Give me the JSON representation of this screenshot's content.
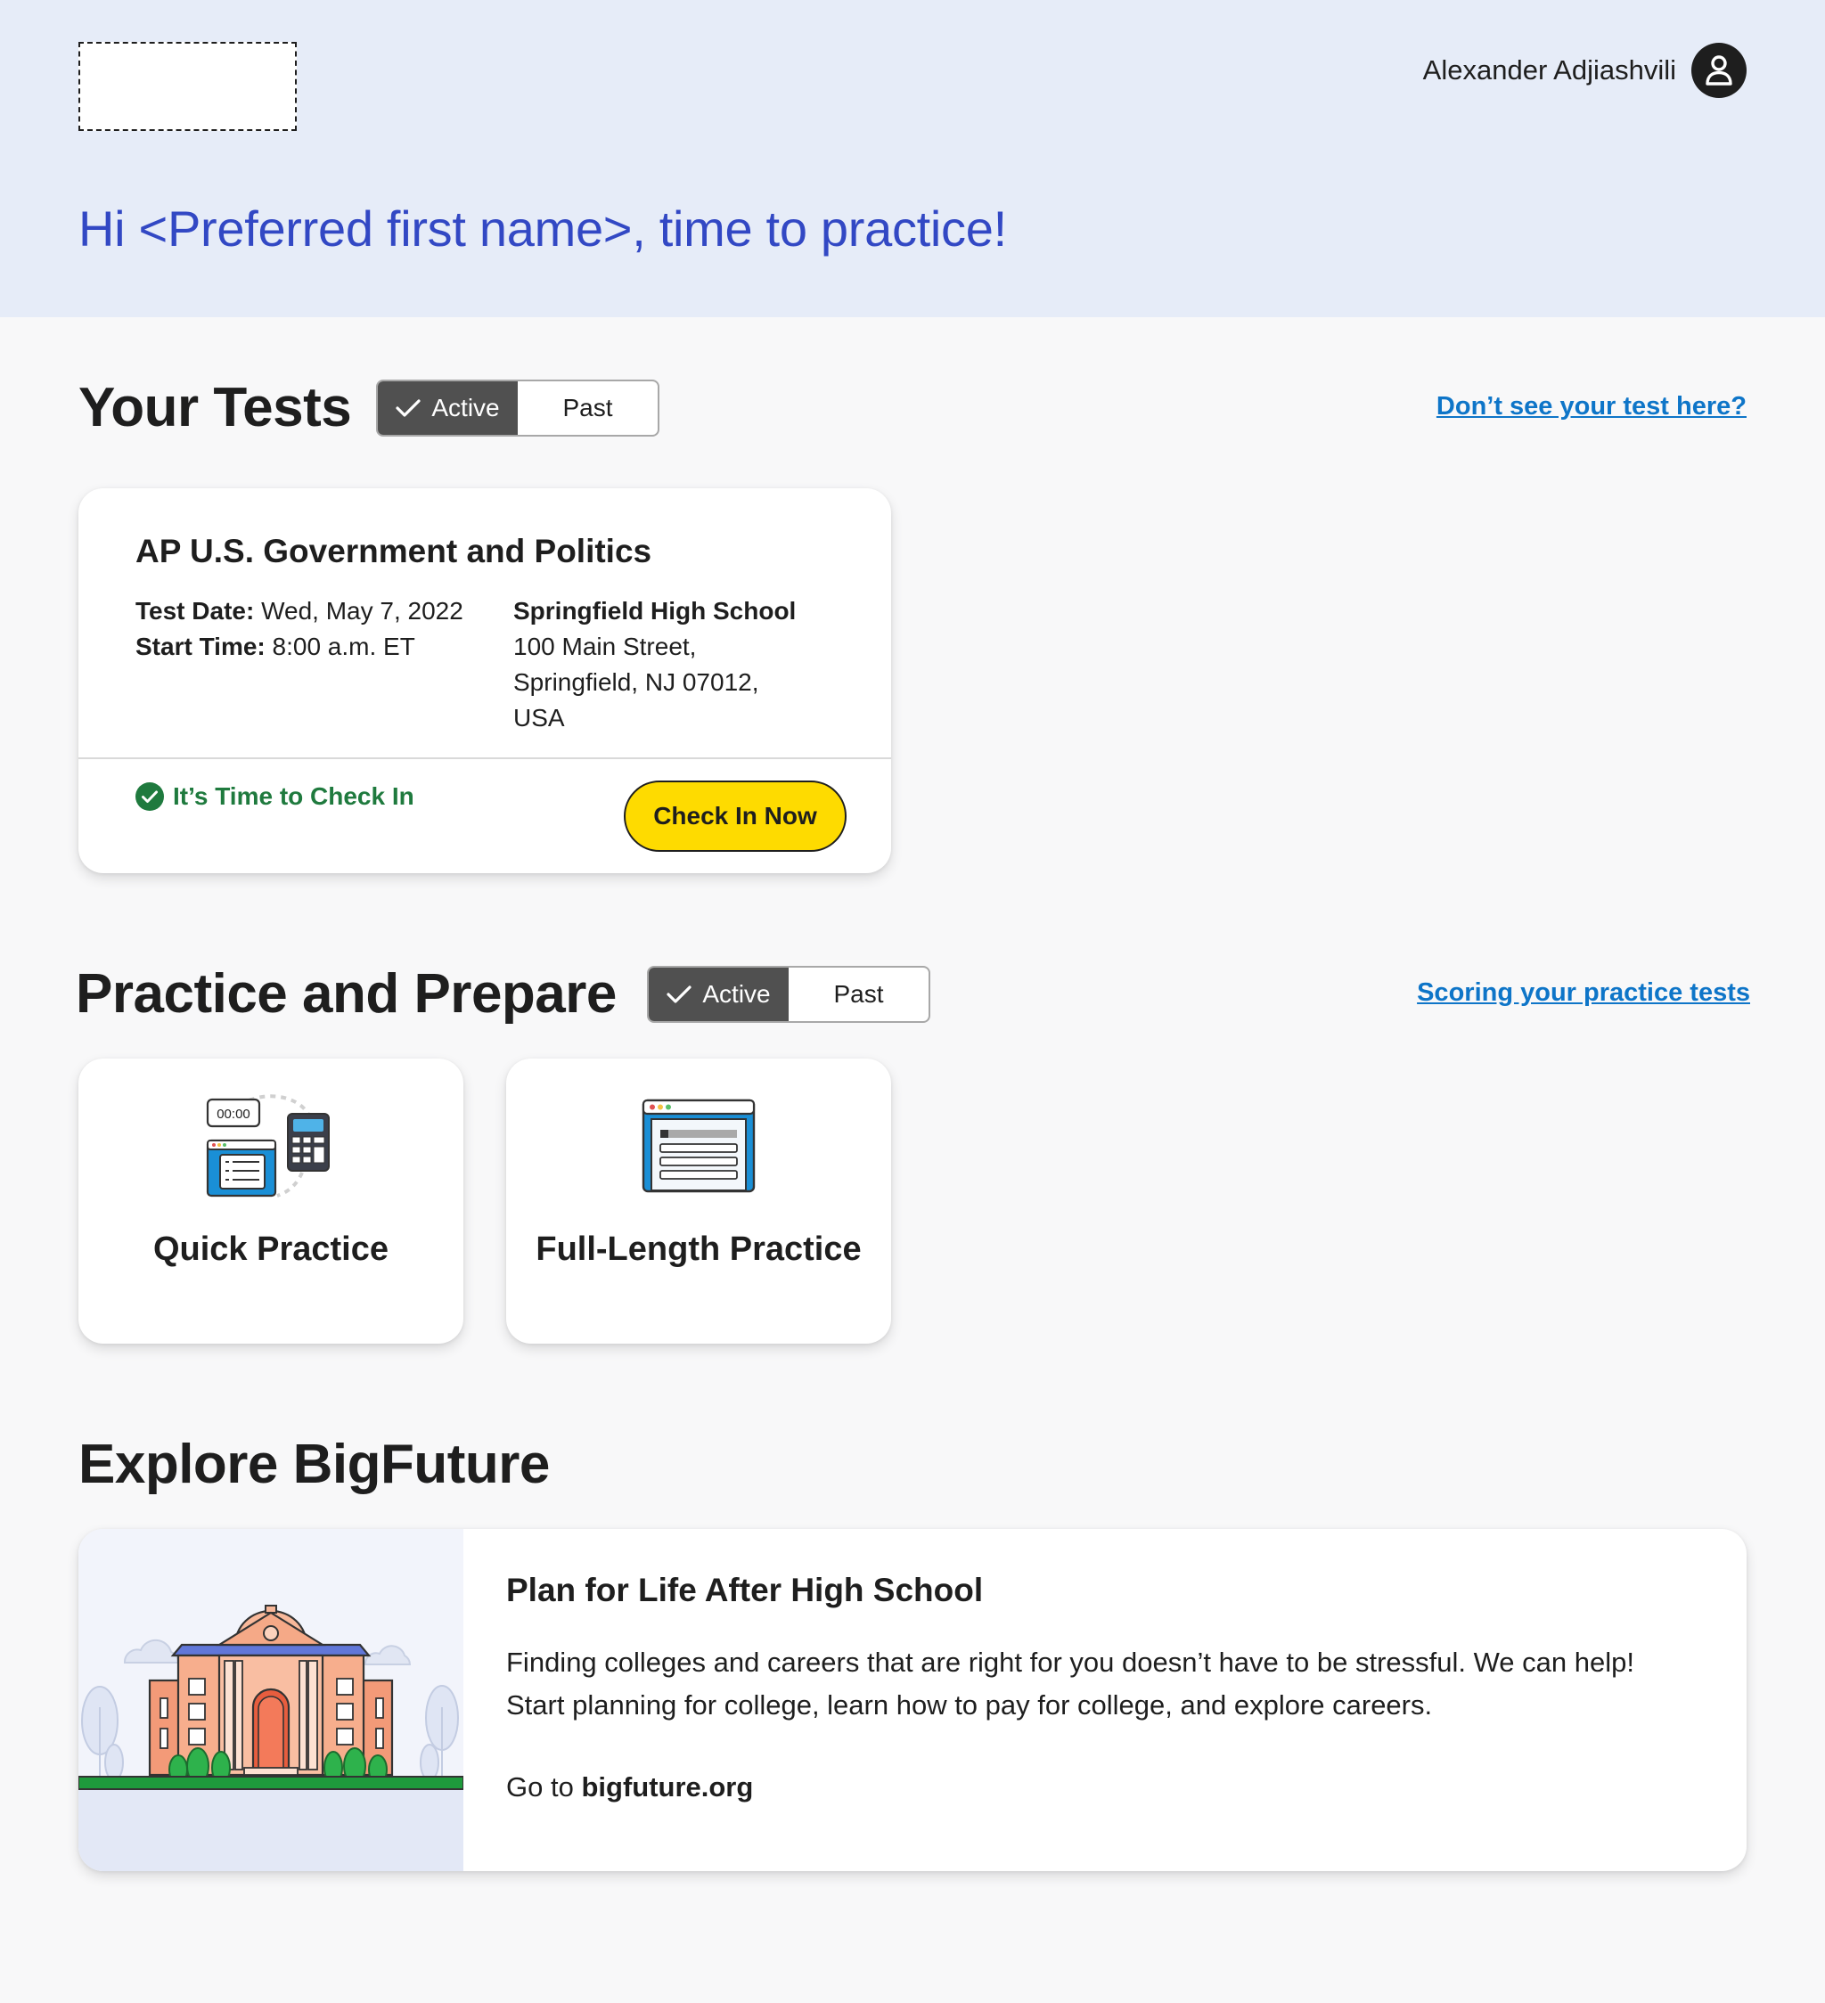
{
  "header": {
    "user_name": "Alexander Adjiashvili",
    "greeting": "Hi <Preferred first name>, time to practice!"
  },
  "your_tests": {
    "title": "Your Tests",
    "toggle": {
      "active": "Active",
      "past": "Past",
      "selected": "Active"
    },
    "help_link": "Don’t see your test here?",
    "card": {
      "title": "AP U.S. Government and Politics",
      "test_date_label": "Test Date:",
      "test_date": "Wed, May 7, 2022",
      "start_time_label": "Start Time:",
      "start_time": "8:00 a.m. ET",
      "location_name": "Springfield High School",
      "address_line1": "100 Main Street,",
      "address_line2": "Springfield, NJ 07012,",
      "address_line3": "USA",
      "status": "It’s Time to Check In",
      "action": "Check In Now"
    }
  },
  "practice": {
    "title": "Practice and Prepare",
    "toggle": {
      "active": "Active",
      "past": "Past",
      "selected": "Active"
    },
    "help_link": "Scoring your practice tests",
    "cards": [
      {
        "label": "Quick Practice",
        "icon": "timer-calculator-icon",
        "timer_text": "00:00"
      },
      {
        "label": "Full-Length Practice",
        "icon": "browser-document-icon"
      }
    ]
  },
  "explore": {
    "title": "Explore BigFuture",
    "card": {
      "title": "Plan for Life After High School",
      "description": "Finding colleges and careers that are right for you doesn’t have to be stressful. We can help! Start planning for college, learn how to pay for college, and explore careers.",
      "go_prefix": "Go to",
      "go_link": "bigfuture.org",
      "illustration": "college-building-icon"
    }
  },
  "colors": {
    "header_bg": "#e6ecf8",
    "greeting": "#3248c4",
    "link": "#0e75c8",
    "primary_button": "#fedb00",
    "status_green": "#1f7a3e",
    "toggle_selected": "#505050"
  }
}
